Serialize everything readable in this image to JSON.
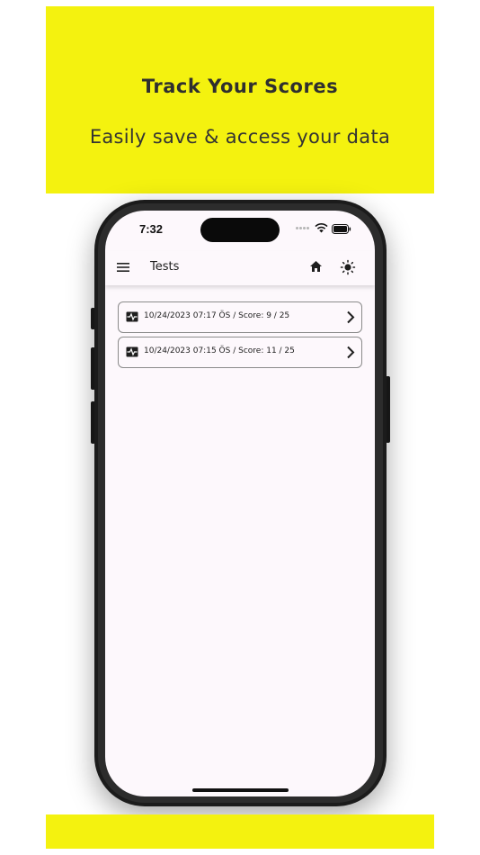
{
  "banner": {
    "title": "Track Your Scores",
    "subtitle": "Easily save & access your data",
    "color": "#f4f20f"
  },
  "status_bar": {
    "time": "7:32",
    "icons": [
      "signal-dots-icon",
      "wifi-icon",
      "battery-icon"
    ]
  },
  "appbar": {
    "title": "Tests",
    "icons": [
      "menu-icon",
      "home-icon",
      "sun-icon"
    ]
  },
  "tests": [
    {
      "date": "10/24/2023 07:17 ÖS",
      "separator": "/",
      "score_label": "Score: 9 / 25",
      "icon": "pulse-icon"
    },
    {
      "date": "10/24/2023 07:15 ÖS",
      "separator": "/",
      "score_label": "Score: 11 / 25",
      "icon": "pulse-icon"
    }
  ]
}
